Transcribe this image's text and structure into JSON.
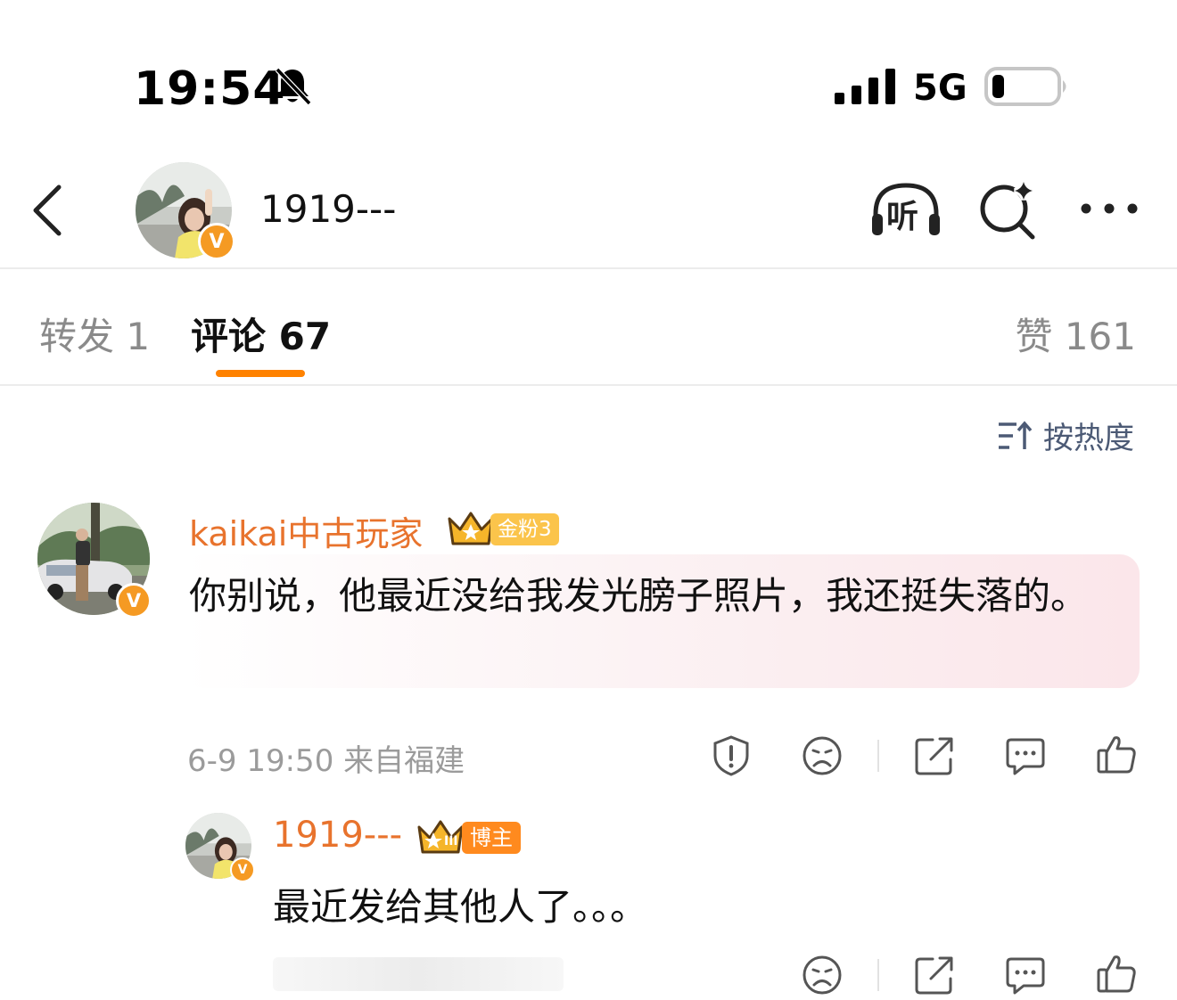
{
  "status_bar": {
    "time": "19:54",
    "network": "5G"
  },
  "header": {
    "title": "1919---",
    "listen_label": "听"
  },
  "tabs": {
    "repost": "转发 1",
    "comment": "评论 67",
    "like": "赞 161"
  },
  "sort": {
    "label": "按热度"
  },
  "comment": {
    "username": "kaikai中古玩家",
    "fan_badge": "金粉3",
    "text": "你别说，他最近没给我发光膀子照片，我还挺失落的。",
    "meta": "6-9 19:50 来自福建",
    "verified_mark": "V"
  },
  "reply": {
    "username": "1919---",
    "badge": "博主",
    "text": "最近发给其他人了。。。",
    "verified_mark": "V",
    "crown_level": "III"
  },
  "colors": {
    "accent_orange": "#ff8200",
    "username_orange": "#e8732d",
    "sort_blue": "#4c5a75",
    "muted_gray": "#9b9b9b"
  },
  "icons": [
    "bell-slash-icon",
    "signal-icon",
    "battery-icon",
    "back-icon",
    "listen-icon",
    "search-sparkle-icon",
    "more-icon",
    "sort-icon",
    "crown-icon",
    "report-icon",
    "dislike-icon",
    "share-icon",
    "reply-icon",
    "like-icon"
  ]
}
